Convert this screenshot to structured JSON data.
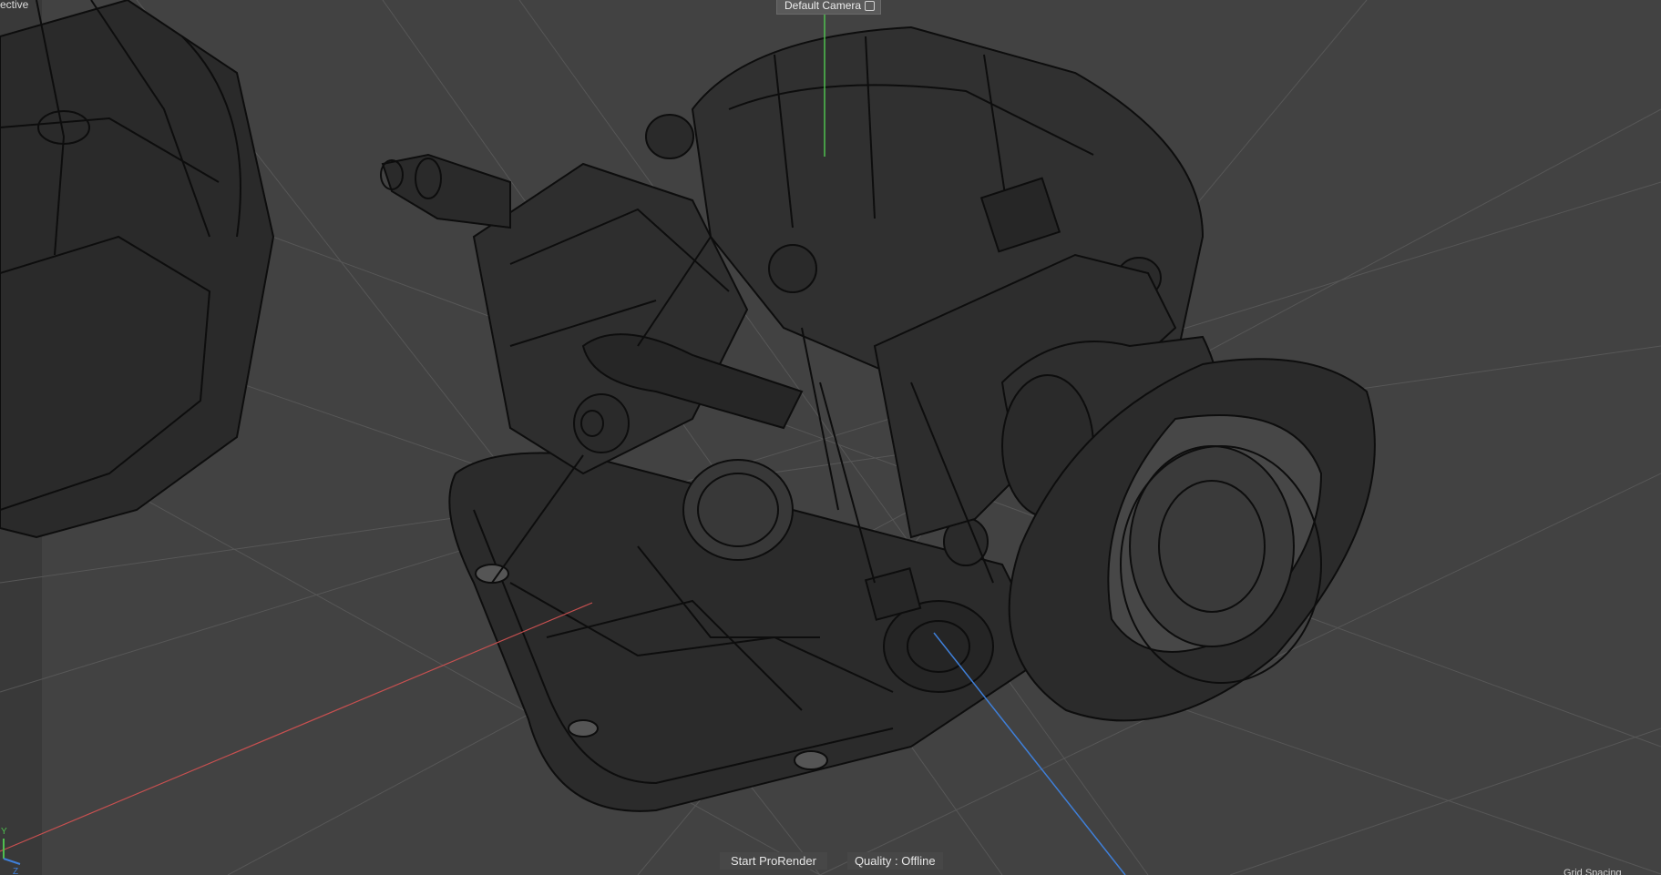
{
  "viewport": {
    "projection_label": "ective",
    "camera_label": "Default Camera",
    "grid_spacing_label": "Grid Spacing"
  },
  "render_bar": {
    "start_label": "Start ProRender",
    "quality_label": "Quality : Offline"
  },
  "axis_gizmo": {
    "y_label": "Y",
    "z_label": "Z"
  },
  "colors": {
    "background": "#424242",
    "x_axis": "#c75050",
    "y_axis": "#4fbf4f",
    "z_axis": "#3f7fd8",
    "wireframe": "#0d0d0d"
  }
}
